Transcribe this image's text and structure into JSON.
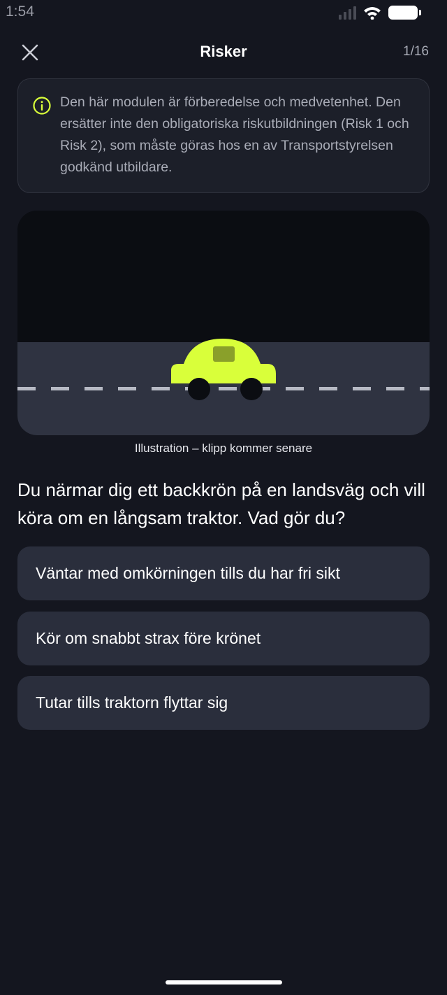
{
  "status_bar": {
    "time": "1:54"
  },
  "header": {
    "title": "Risker",
    "progress": "1/16"
  },
  "info": {
    "text": "Den här modulen är förberedelse och medvetenhet. Den ersätter inte den obligatoriska riskutbildningen (Risk 1 och Risk 2), som måste göras hos en av Transportstyrelsen godkänd utbildare."
  },
  "illustration": {
    "caption": "Illustration – klipp kommer senare",
    "car_color": "#d9ff3a"
  },
  "question": {
    "text": "Du närmar dig ett backkrön på en landsväg och vill köra om en långsam traktor. Vad gör du?"
  },
  "answers": [
    {
      "label": "Väntar med omkörningen tills du har fri sikt"
    },
    {
      "label": "Kör om snabbt strax före krönet"
    },
    {
      "label": "Tutar tills traktorn flyttar sig"
    }
  ],
  "colors": {
    "accent": "#d9ff3a",
    "background": "#14161f",
    "card": "#2a2e3c"
  }
}
